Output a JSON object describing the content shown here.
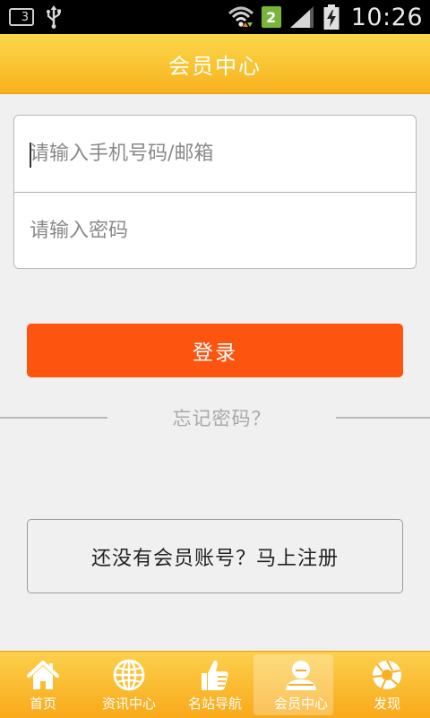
{
  "status_bar": {
    "notification_count": "3",
    "sim_number": "2",
    "time": "10:26",
    "icons": [
      "usb-icon",
      "wifi-icon",
      "signal-icon",
      "battery-charging-icon"
    ]
  },
  "header": {
    "title": "会员中心"
  },
  "login_form": {
    "username_placeholder": "请输入手机号码/邮箱",
    "password_placeholder": "请输入密码"
  },
  "login_button": {
    "label": "登录"
  },
  "forgot_password": {
    "label": "忘记密码？"
  },
  "register_button": {
    "label": "还没有会员账号？马上注册"
  },
  "bottom_nav": {
    "items": [
      {
        "label": "首页",
        "icon": "home-icon"
      },
      {
        "label": "资讯中心",
        "icon": "globe-icon"
      },
      {
        "label": "名站导航",
        "icon": "thumbs-up-icon"
      },
      {
        "label": "会员中心",
        "icon": "user-icon",
        "active": true
      },
      {
        "label": "发现",
        "icon": "camera-shutter-icon"
      }
    ]
  },
  "colors": {
    "header_top": "#fbd84a",
    "header_bottom": "#f8b21e",
    "login_button": "#fd5410",
    "background": "#f0f0f0"
  }
}
